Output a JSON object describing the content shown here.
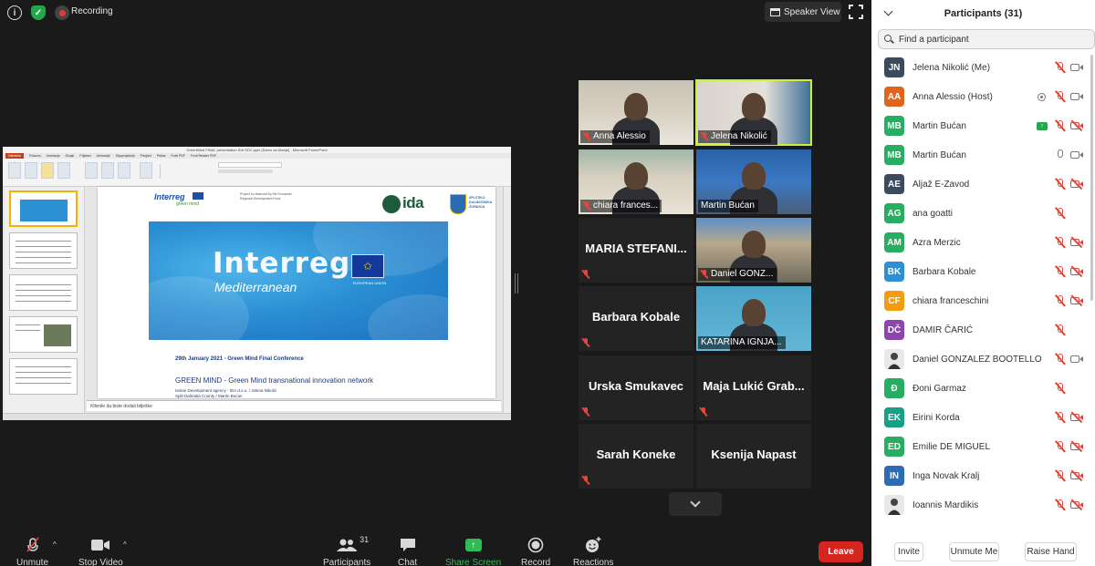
{
  "topbar": {
    "recording_label": "Recording",
    "speaker_view_label": "Speaker View"
  },
  "presentation": {
    "window_title": "GreenMind FINAL presentation IDA SDC.pptx [Samo za čitanje] - Microsoft PowerPoint",
    "ribbon_tabs": [
      "Datoteka",
      "Polazno",
      "Umetanje",
      "Dizajn",
      "Prijelazi",
      "Animacije",
      "Dijaprojekcija",
      "Pregled",
      "Prikaz",
      "Foxit PDF",
      "Foxit Reader PDF"
    ],
    "slide": {
      "logo_small": "Interreg",
      "green_mind": "green mind",
      "project_note": "Project co-financed by the European Regional Development Fund",
      "ida_logo": "ida",
      "county_logo": "SPLITSKO DALMATINSKA ŽUPANIJA",
      "banner_title": "Interreg",
      "banner_subtitle": "Mediterranean",
      "banner_eu": "EUROPEAN UNION",
      "date_line": "29th January 2021 - Green Mind Final Conference",
      "heading": "GREEN MIND - Green Mind transnational innovation network",
      "author_line_1": "Istrian Development agency - IDA d.o.o. / Jelena Nikolić",
      "author_line_2": "Split Dalmatia County / Martin Bućan"
    },
    "notes_placeholder": "Kliknite da biste dodali bilješke"
  },
  "video_tiles": [
    {
      "name": "Anna Alessio",
      "type": "video",
      "muted": true
    },
    {
      "name": "Jelena Nikolić",
      "type": "video",
      "muted": true,
      "active_speaker": true
    },
    {
      "name": "chiara frances...",
      "type": "video",
      "muted": true
    },
    {
      "name": "Martin Bućan",
      "type": "video",
      "muted": false
    },
    {
      "name": "MARIA  STEFANI...",
      "type": "name",
      "muted": true
    },
    {
      "name": "Daniel GONZ...",
      "type": "video",
      "muted": true
    },
    {
      "name": "Barbara Kobale",
      "type": "name",
      "muted": true
    },
    {
      "name": "KATARINA IGNJA...",
      "type": "video",
      "muted": false
    },
    {
      "name": "Urska Smukavec",
      "type": "name",
      "muted": true
    },
    {
      "name": "Maja Lukić Grab...",
      "type": "name",
      "muted": true
    },
    {
      "name": "Sarah Koneke",
      "type": "name",
      "muted": true
    },
    {
      "name": "Ksenija Napast",
      "type": "name",
      "muted": false
    }
  ],
  "toolbar": {
    "unmute": "Unmute",
    "stop_video": "Stop Video",
    "participants": "Participants",
    "participants_count": "31",
    "chat": "Chat",
    "share_screen": "Share Screen",
    "record": "Record",
    "reactions": "Reactions",
    "leave": "Leave"
  },
  "panel": {
    "title": "Participants (31)",
    "search_placeholder": "Find a participant",
    "participants": [
      {
        "initials": "JN",
        "name": "Jelena Nikolić (Me)",
        "color": "#3b4a5c",
        "mic": "off",
        "cam": "on"
      },
      {
        "initials": "AA",
        "name": "Anna Alessio (Host)",
        "color": "#e0641b",
        "mic": "off",
        "cam": "on",
        "host_icon": true
      },
      {
        "initials": "MB",
        "name": "Martin Bućan",
        "color": "#27ae60",
        "mic": "off",
        "cam": "off",
        "sharing": true
      },
      {
        "initials": "MB",
        "name": "Martin Bućan",
        "color": "#27ae60",
        "mic": "on",
        "cam": "on"
      },
      {
        "initials": "AE",
        "name": "Aljaž E-Zavod",
        "color": "#3b4a5c",
        "mic": "off",
        "cam": "off"
      },
      {
        "initials": "AG",
        "name": "ana goatti",
        "color": "#27ae60",
        "mic": "off",
        "cam": "none"
      },
      {
        "initials": "AM",
        "name": "Azra Merzic",
        "color": "#27ae60",
        "mic": "off",
        "cam": "off"
      },
      {
        "initials": "BK",
        "name": "Barbara Kobale",
        "color": "#2d8fd5",
        "mic": "off",
        "cam": "off"
      },
      {
        "initials": "CF",
        "name": "chiara franceschini",
        "color": "#f39c12",
        "mic": "off",
        "cam": "off"
      },
      {
        "initials": "DČ",
        "name": "DAMIR ČARIĆ",
        "color": "#8e44ad",
        "mic": "off",
        "cam": "none"
      },
      {
        "initials": "",
        "name": "Daniel GONZALEZ BOOTELLO",
        "color": "#ffffff",
        "mic": "off",
        "cam": "on",
        "photo": true
      },
      {
        "initials": "Đ",
        "name": "Đoni Garmaz",
        "color": "#27ae60",
        "mic": "off",
        "cam": "none"
      },
      {
        "initials": "EK",
        "name": "Eirini Korda",
        "color": "#16a085",
        "mic": "off",
        "cam": "off"
      },
      {
        "initials": "ED",
        "name": "Emilie DE MIGUEL",
        "color": "#27ae60",
        "mic": "off",
        "cam": "off"
      },
      {
        "initials": "IN",
        "name": "Inga Novak Kralj",
        "color": "#2d6cb5",
        "mic": "off",
        "cam": "off"
      },
      {
        "initials": "",
        "name": "Ioannis Mardikis",
        "color": "#ffffff",
        "mic": "off",
        "cam": "off",
        "photo": true
      }
    ],
    "invite": "Invite",
    "unmute_me": "Unmute Me",
    "raise_hand": "Raise Hand"
  }
}
